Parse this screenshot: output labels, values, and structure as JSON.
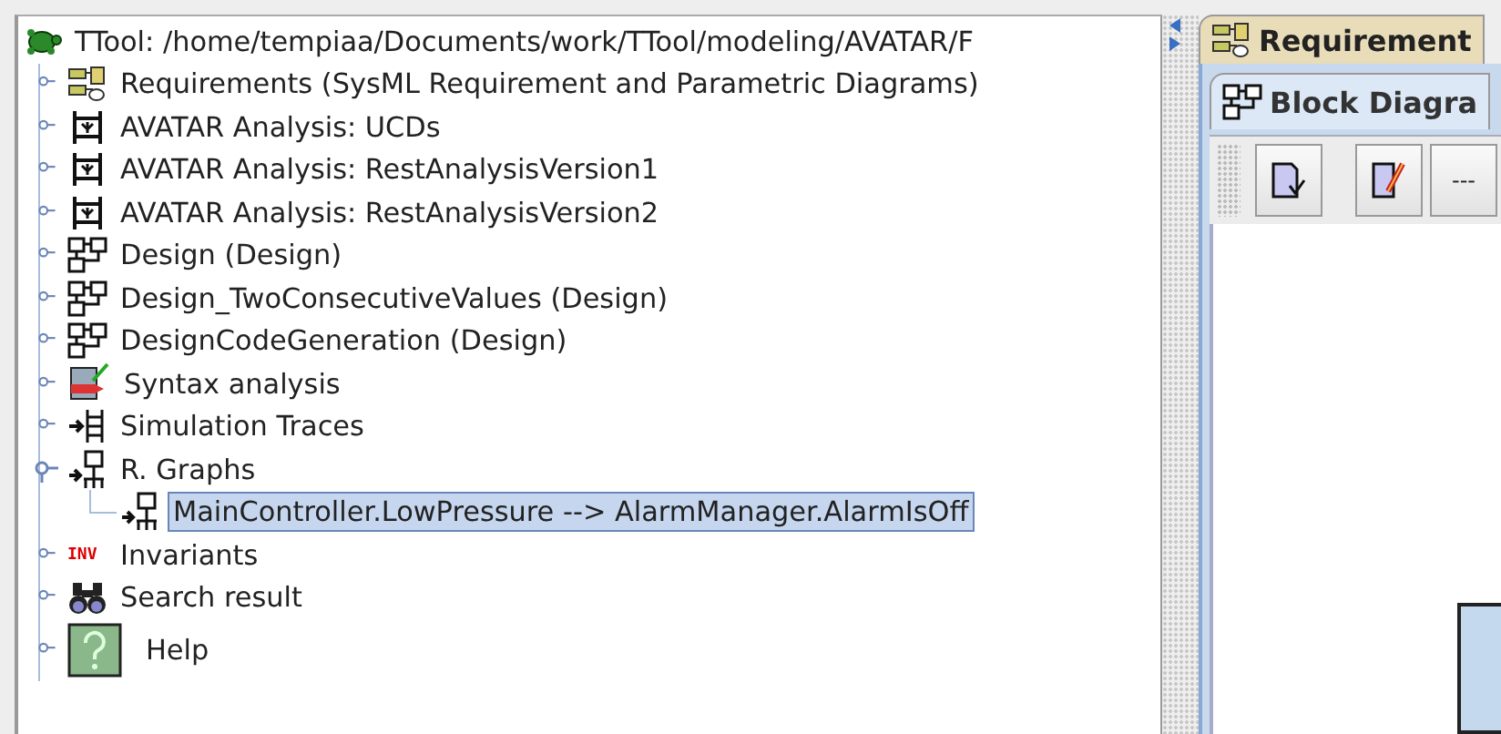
{
  "tree": {
    "root": {
      "label": "TTool: /home/tempiaa/Documents/work/TTool/modeling/AVATAR/F",
      "children": [
        {
          "label": "Requirements (SysML Requirement and Parametric Diagrams)",
          "kind": "requirement",
          "expanded": false,
          "selected": false
        },
        {
          "label": "AVATAR Analysis: UCDs",
          "kind": "analysis",
          "expanded": false,
          "selected": false
        },
        {
          "label": "AVATAR Analysis: RestAnalysisVersion1",
          "kind": "analysis",
          "expanded": false,
          "selected": false
        },
        {
          "label": "AVATAR Analysis: RestAnalysisVersion2",
          "kind": "analysis",
          "expanded": false,
          "selected": false
        },
        {
          "label": "Design (Design)",
          "kind": "design",
          "expanded": false,
          "selected": false
        },
        {
          "label": "Design_TwoConsecutiveValues (Design)",
          "kind": "design",
          "expanded": false,
          "selected": false
        },
        {
          "label": "DesignCodeGeneration (Design)",
          "kind": "design",
          "expanded": false,
          "selected": false
        },
        {
          "label": "Syntax analysis",
          "kind": "syntax",
          "expanded": false,
          "selected": false
        },
        {
          "label": "Simulation Traces",
          "kind": "simulation",
          "expanded": false,
          "selected": false
        },
        {
          "label": "R. Graphs",
          "kind": "graph",
          "expanded": true,
          "selected": false,
          "children": [
            {
              "label": "MainController.LowPressure --> AlarmManager.AlarmIsOff",
              "kind": "graph",
              "selected": true
            }
          ]
        },
        {
          "label": "Invariants",
          "kind": "invariants",
          "icon_text": "INV",
          "expanded": false,
          "selected": false
        },
        {
          "label": "Search result",
          "kind": "search",
          "expanded": false,
          "selected": false
        },
        {
          "label": "Help",
          "kind": "help",
          "expanded": false,
          "selected": false
        }
      ]
    }
  },
  "tabs": [
    {
      "label": "Requirement",
      "kind": "requirement",
      "selected": true
    }
  ],
  "subtabs": [
    {
      "label": "Block Diagra",
      "kind": "design",
      "selected": true
    }
  ],
  "toolbar": [
    {
      "kind": "edit"
    },
    {
      "kind": "pencil"
    },
    {
      "kind": "text",
      "label": "---"
    }
  ]
}
